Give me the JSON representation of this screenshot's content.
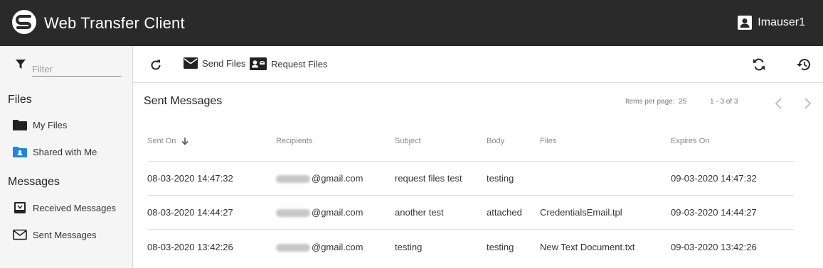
{
  "app": {
    "title": "Web Transfer Client",
    "user": "Imauser1"
  },
  "sidebar": {
    "filter_placeholder": "Filter",
    "files_heading": "Files",
    "files_items": [
      {
        "label": "My Files"
      },
      {
        "label": "Shared with Me"
      }
    ],
    "messages_heading": "Messages",
    "messages_items": [
      {
        "label": "Received Messages"
      },
      {
        "label": "Sent Messages"
      }
    ]
  },
  "toolbar": {
    "send_files": "Send Files",
    "request_files": "Request Files"
  },
  "main": {
    "title": "Sent Messages",
    "items_per_page_label": "Items per page:",
    "items_per_page_value": "25",
    "range": "1 - 3 of 3",
    "columns": [
      "Sent On",
      "Recipients",
      "Subject",
      "Body",
      "Files",
      "Expires On"
    ],
    "rows": [
      {
        "sent_on": "08-03-2020 14:47:32",
        "recipient": "@gmail.com",
        "subject": "request files test",
        "body": "testing",
        "files": "",
        "expires_on": "09-03-2020 14:47:32"
      },
      {
        "sent_on": "08-03-2020 14:44:27",
        "recipient": "@gmail.com",
        "subject": "another test",
        "body": "attached",
        "files": "CredentialsEmail.tpl",
        "expires_on": "09-03-2020 14:44:27"
      },
      {
        "sent_on": "08-03-2020 13:42:26",
        "recipient": "@gmail.com",
        "subject": "testing",
        "body": "testing",
        "files": "New Text Document.txt",
        "expires_on": "09-03-2020 13:42:26"
      }
    ]
  },
  "colors": {
    "appbar": "#2a2a2a",
    "sidebar": "#f5f5f5",
    "accent": "#1e88d8"
  }
}
